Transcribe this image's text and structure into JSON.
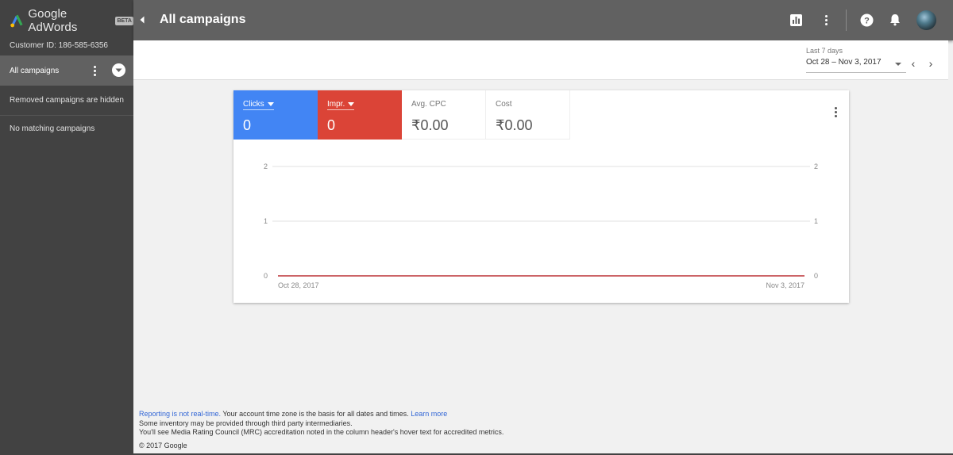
{
  "app": {
    "brand": "Google AdWords",
    "beta_badge": "BETA"
  },
  "sidebar": {
    "customer_id": "Customer ID: 186-585-6356",
    "selected_item": "All campaigns",
    "removed_note": "Removed campaigns are hidden",
    "empty_note": "No matching campaigns"
  },
  "header": {
    "title": "All campaigns",
    "icons": [
      "reports-icon",
      "more-vert-icon",
      "help-icon",
      "notifications-icon",
      "avatar"
    ]
  },
  "date_range": {
    "label": "Last 7 days",
    "value": "Oct 28 – Nov 3, 2017",
    "prev_glyph": "‹",
    "next_glyph": "›"
  },
  "metrics": [
    {
      "label": "Clicks",
      "value": "0",
      "color": "#4285f4",
      "active": true
    },
    {
      "label": "Impr.",
      "value": "0",
      "color": "#db4437",
      "active": true
    },
    {
      "label": "Avg. CPC",
      "value": "₹0.00",
      "active": false
    },
    {
      "label": "Cost",
      "value": "₹0.00",
      "active": false
    }
  ],
  "chart_data": {
    "type": "line",
    "x": [
      "Oct 28, 2017",
      "Nov 3, 2017"
    ],
    "series": [
      {
        "name": "Clicks",
        "color": "#4285f4",
        "values": [
          0,
          0
        ]
      },
      {
        "name": "Impr.",
        "color": "#db4437",
        "values": [
          0,
          0
        ]
      }
    ],
    "ylim": [
      0,
      2
    ],
    "y_ticks": [
      "0",
      "1",
      "2"
    ],
    "x_tick_labels": [
      "Oct 28, 2017",
      "Nov 3, 2017"
    ],
    "grid": true,
    "legend": "none"
  },
  "footer": {
    "link1": "Reporting is not real-time.",
    "text1": " Your account time zone is the basis for all dates and times. ",
    "link2": "Learn more",
    "line2": "Some inventory may be provided through third party intermediaries.",
    "line3": "You'll see Media Rating Council (MRC) accreditation noted in the column header's hover text for accredited metrics.",
    "copyright": "© 2017 Google"
  },
  "colors": {
    "sidebar_bg": "#424242",
    "topbar_bg": "#616161",
    "selected_item_bg": "#616161",
    "clicks": "#4285f4",
    "impressions": "#db4437",
    "link": "#3367d6"
  }
}
